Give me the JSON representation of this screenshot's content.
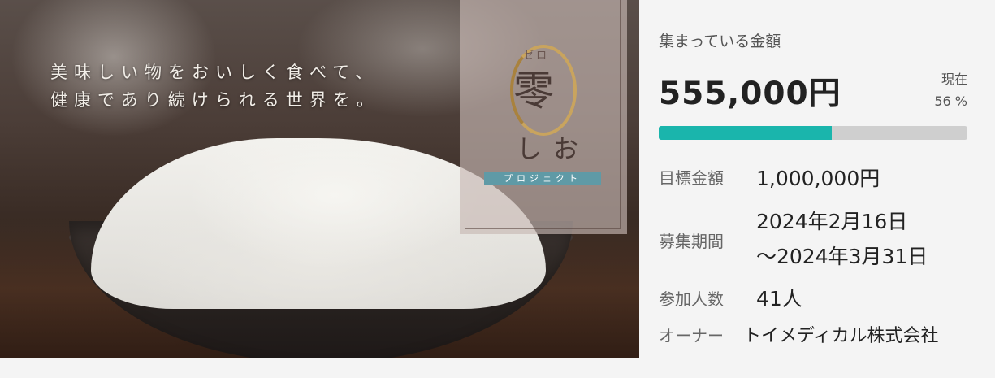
{
  "hero": {
    "tagline_line1": "美味しい物をおいしく食べて、",
    "tagline_line2": "健康であり続けられる世界を。",
    "logo": {
      "ruby": "ゼロ",
      "kanji": "零",
      "sub": "しお",
      "badge": "プロジェクト"
    }
  },
  "funding": {
    "title": "集まっている金額",
    "amount": "555,000円",
    "now_label": "現在",
    "percent_text": "56 %",
    "progress_fraction": 0.56,
    "accent_color": "#1ab5ac"
  },
  "details": {
    "goal_label": "目標金額",
    "goal_value": "1,000,000円",
    "period_label": "募集期間",
    "period_start": "2024年2月16日",
    "period_end": "～2024年3月31日",
    "participants_label": "参加人数",
    "participants_value": "41人",
    "owner_label": "オーナー",
    "owner_value": "トイメディカル株式会社"
  }
}
